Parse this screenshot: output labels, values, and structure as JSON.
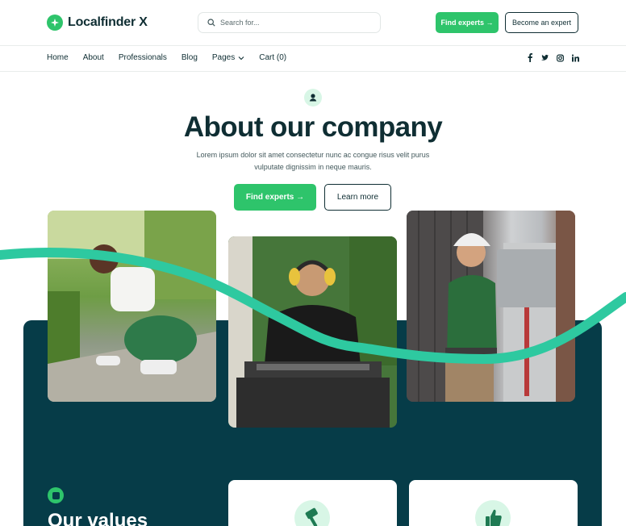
{
  "brand": {
    "name": "Localfinder X",
    "accent": "#2ec46b",
    "dark": "#063c48"
  },
  "search": {
    "placeholder": "Search for..."
  },
  "header": {
    "find_experts": "Find experts →",
    "become_expert": "Become an expert"
  },
  "nav": {
    "items": [
      "Home",
      "About",
      "Professionals",
      "Blog",
      "Pages",
      "Cart (0)"
    ],
    "social": [
      "facebook-icon",
      "twitter-icon",
      "instagram-icon",
      "linkedin-icon"
    ]
  },
  "hero": {
    "title": "About our company",
    "subtitle": "Lorem ipsum dolor sit amet consectetur nunc ac congue risus velit purus vulputate dignissim in neque mauris.",
    "find_experts": "Find experts →",
    "learn_more": "Learn more"
  },
  "values": {
    "title": "Our values"
  }
}
